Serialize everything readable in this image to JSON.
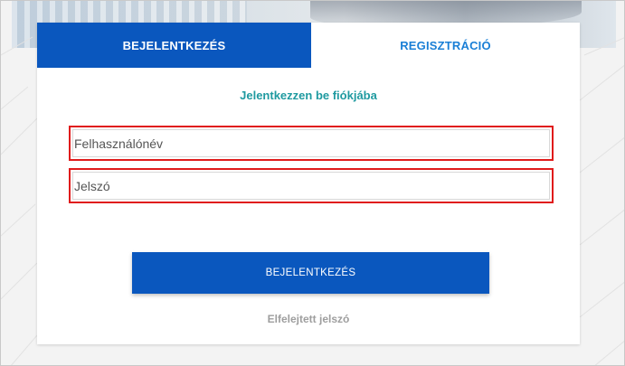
{
  "tabs": {
    "login_label": "BEJELENTKEZÉS",
    "register_label": "REGISZTRÁCIÓ"
  },
  "form": {
    "subtitle": "Jelentkezzen be fiókjába",
    "username_placeholder": "Felhasználónév",
    "username_value": "",
    "password_placeholder": "Jelszó",
    "password_value": "",
    "submit_label": "BEJELENTKEZÉS",
    "forgot_label": "Elfelejtett jelszó"
  },
  "colors": {
    "primary": "#0a57be",
    "subtitle": "#1f9aa0",
    "register_tab_text": "#1a7fd6",
    "highlight_border": "#e01b1b",
    "muted_link": "#9e9e9e"
  }
}
